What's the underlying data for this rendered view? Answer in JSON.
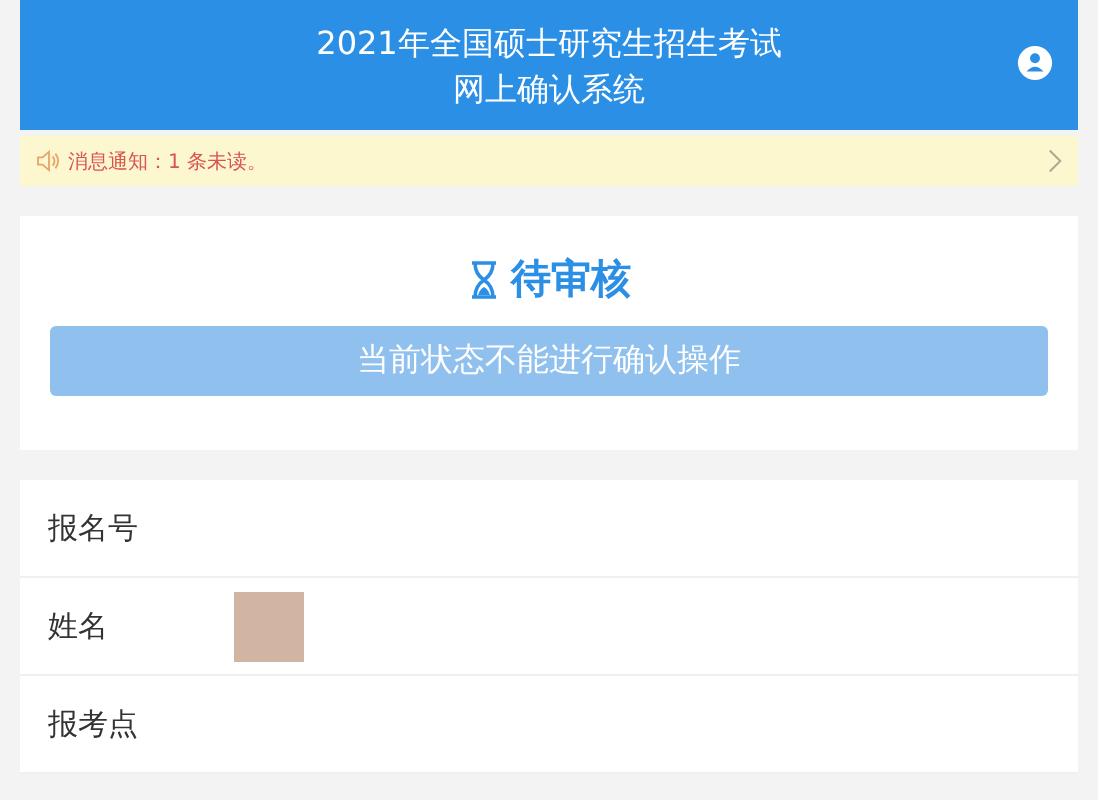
{
  "header": {
    "title_lines": [
      "2021年全国硕士研究生招生考试",
      "网上确认系统"
    ]
  },
  "notice": {
    "text": "消息通知：1 条未读。"
  },
  "status": {
    "title": "待审核",
    "action": {
      "label": "当前状态不能进行确认操作",
      "disabled": true
    }
  },
  "info_rows": [
    {
      "label": "报名号",
      "redacted": false
    },
    {
      "label": "姓名",
      "redacted": true
    },
    {
      "label": "报考点",
      "redacted": false
    }
  ]
}
